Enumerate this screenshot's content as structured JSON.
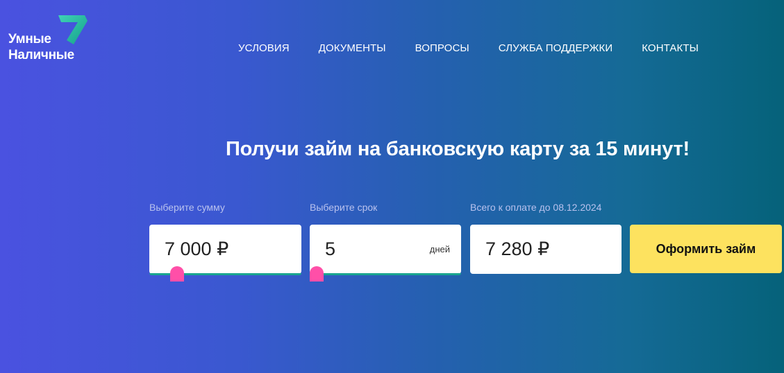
{
  "brand": {
    "line1": "Умные",
    "line2": "Наличные"
  },
  "nav": {
    "items": [
      {
        "label": "УСЛОВИЯ"
      },
      {
        "label": "ДОКУМЕНТЫ"
      },
      {
        "label": "ВОПРОСЫ"
      },
      {
        "label": "СЛУЖБА ПОДДЕРЖКИ"
      },
      {
        "label": "КОНТАКТЫ"
      }
    ]
  },
  "hero": {
    "headline": "Получи займ на банковскую карту за 15 минут!"
  },
  "calculator": {
    "amount": {
      "label": "Выберите сумму",
      "value": "7 000 ₽",
      "slider_fraction": 0.0
    },
    "term": {
      "label": "Выберите срок",
      "value": "5",
      "unit": "дней",
      "slider_fraction": 0.0
    },
    "total": {
      "label": "Всего к оплате до 08.12.2024",
      "value": "7 280 ₽"
    },
    "submit_label": "Оформить займ"
  },
  "colors": {
    "accent_button": "#fde25f",
    "slider_knob": "#ff4fa8",
    "slider_track": "#1aa58f"
  }
}
